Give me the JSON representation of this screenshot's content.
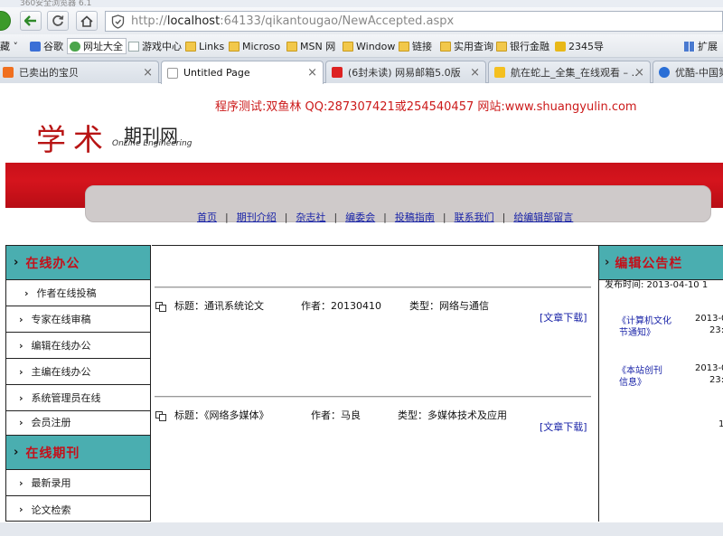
{
  "browser": {
    "window_title": "360安全浏览器 6.1",
    "url_prefix": "http://",
    "url_host": "localhost",
    "url_rest": ":64133/qikantougao/NewAccepted.aspx",
    "bookmarks": [
      {
        "label": "藏 ˅",
        "icon": "none"
      },
      {
        "label": "谷歌",
        "icon": "google-icon"
      },
      {
        "label": "网址大全",
        "icon": "nav-icon"
      },
      {
        "label": "游戏中心",
        "icon": "page-icon"
      },
      {
        "label": "Links",
        "icon": "folder-icon"
      },
      {
        "label": "Microso",
        "icon": "folder-icon"
      },
      {
        "label": "MSN 网",
        "icon": "folder-icon"
      },
      {
        "label": "Window",
        "icon": "folder-icon"
      },
      {
        "label": "链接",
        "icon": "folder-icon"
      },
      {
        "label": "实用查询",
        "icon": "folder-icon"
      },
      {
        "label": "银行金融",
        "icon": "folder-icon"
      },
      {
        "label": "2345导",
        "icon": "site-icon"
      }
    ],
    "extensions_label": "扩展",
    "tabs": [
      {
        "label": "已卖出的宝贝",
        "close": "×"
      },
      {
        "label": "Untitled Page",
        "close": "×"
      },
      {
        "label": "(6封未读) 网易邮箱5.0版",
        "close": "×"
      },
      {
        "label": "航在蛇上_全集_在线观看 – …",
        "close": "×"
      },
      {
        "label": "优酷-中国第",
        "close": ""
      }
    ]
  },
  "header": {
    "notice": "程序测试:双鱼林 QQ:287307421或254540457 网站:www.shuangyulin.com",
    "logo_big": "学术",
    "logo_small": "期刊网",
    "logo_sub": "OnLine Engineering"
  },
  "nav": [
    "首页",
    "期刊介绍",
    "杂志社",
    "编委会",
    "投稿指南",
    "联系我们",
    "给编辑部留言"
  ],
  "nav_separator": "|",
  "left_sidebar": {
    "section1": {
      "title": "在线办公",
      "items": [
        "作者在线投稿",
        "专家在线审稿",
        "编辑在线办公",
        "主编在线办公",
        "系统管理员在线",
        "会员注册"
      ]
    },
    "section2": {
      "title": "在线期刊",
      "items": [
        "最新录用",
        "论文检索"
      ]
    }
  },
  "articles": [
    {
      "title": "标题：通讯系统论文",
      "author": "作者：20130410",
      "type": "类型：网络与通信",
      "download": "[文章下载]"
    },
    {
      "title": "标题：《网络多媒体》",
      "author": "作者：马良",
      "type": "类型：多媒体技术及应用",
      "download": "[文章下载]"
    }
  ],
  "right_sidebar": {
    "title": "编辑公告栏",
    "top_clip": "发布时间: 2013-04-10 1",
    "notices": [
      {
        "title_line1": "《计算机文化",
        "title_line2": "节通知》",
        "date_line1": "2013-0",
        "date_line2": "23:4"
      },
      {
        "title_line1": "《本站创刊",
        "title_line2": "信息》",
        "date_line1": "2013-0",
        "date_line2": "23:4"
      }
    ],
    "bottom_clip": "1"
  }
}
